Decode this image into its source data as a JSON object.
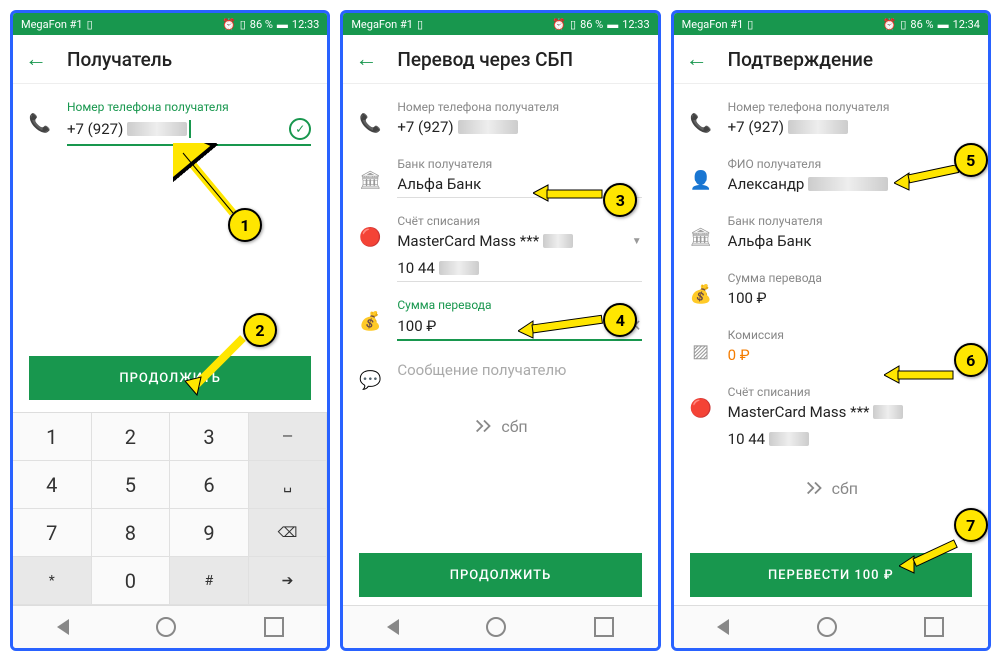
{
  "status": {
    "carrier": "MegaFon #1",
    "batt": "86 %",
    "time1": "12:33",
    "time2": "12:33",
    "time3": "12:34"
  },
  "s1": {
    "title": "Получатель",
    "phoneLabel": "Номер телефона получателя",
    "phonePrefix": "+7 (927)",
    "btn": "ПРОДОЛЖИТЬ"
  },
  "s2": {
    "title": "Перевод через СБП",
    "phoneLabel": "Номер телефона получателя",
    "phonePrefix": "+7 (927)",
    "bankLabel": "Банк получателя",
    "bankVal": "Альфа Банк",
    "acctLabel": "Счёт списания",
    "acctVal1": "MasterCard Mass ***",
    "acctVal2": "10 44",
    "amtLabel": "Сумма перевода",
    "amtVal": "100 ₽",
    "msgPh": "Сообщение получателю",
    "sbp": "сбп",
    "btn": "ПРОДОЛЖИТЬ"
  },
  "s3": {
    "title": "Подтверждение",
    "phoneLabel": "Номер телефона получателя",
    "phonePrefix": "+7 (927)",
    "nameLabel": "ФИО получателя",
    "nameVal": "Александр",
    "bankLabel": "Банк получателя",
    "bankVal": "Альфа Банк",
    "amtLabel": "Сумма перевода",
    "amtVal": "100 ₽",
    "feeLabel": "Комиссия",
    "feeVal": "0 ₽",
    "acctLabel": "Счёт списания",
    "acctVal1": "MasterCard Mass ***",
    "acctVal2": "10 44",
    "sbp": "сбп",
    "btn": "ПЕРЕВЕСТИ 100 ₽"
  },
  "markers": [
    "1",
    "2",
    "3",
    "4",
    "5",
    "6",
    "7"
  ]
}
